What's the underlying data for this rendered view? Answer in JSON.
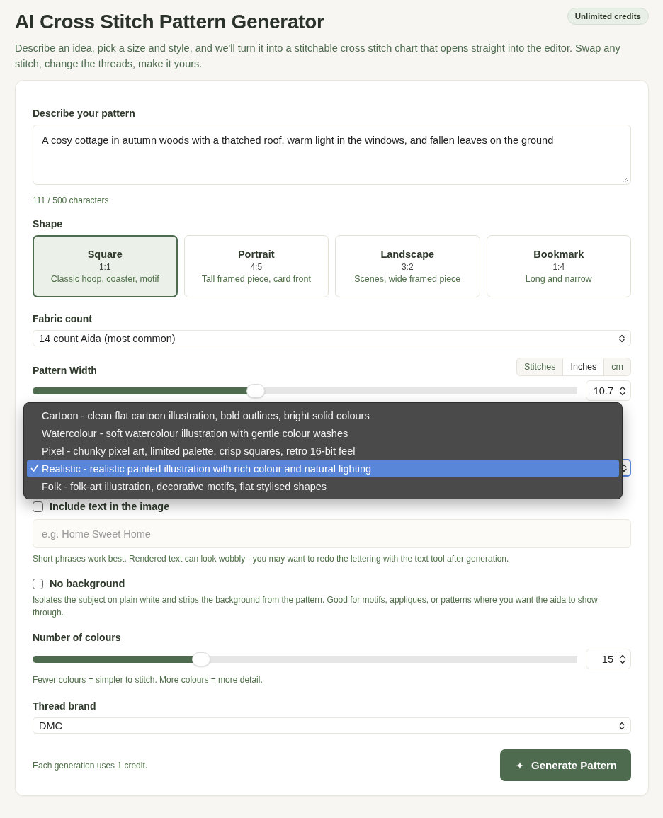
{
  "header": {
    "title": "AI Cross Stitch Pattern Generator",
    "badge": "Unlimited credits",
    "intro": "Describe an idea, pick a size and style, and we'll turn it into a stitchable cross stitch chart that opens straight into the editor. Swap any stitch, change the threads, make it yours."
  },
  "description": {
    "label": "Describe your pattern",
    "value": "A cosy cottage in autumn woods with a thatched roof, warm light in the windows, and fallen leaves on the ground",
    "counter": "111 / 500 characters"
  },
  "shape": {
    "label": "Shape",
    "options": [
      {
        "name": "Square",
        "ratio": "1:1",
        "desc": "Classic hoop, coaster, motif",
        "selected": true
      },
      {
        "name": "Portrait",
        "ratio": "4:5",
        "desc": "Tall framed piece, card front",
        "selected": false
      },
      {
        "name": "Landscape",
        "ratio": "3:2",
        "desc": "Scenes, wide framed piece",
        "selected": false
      },
      {
        "name": "Bookmark",
        "ratio": "1:4",
        "desc": "Long and narrow",
        "selected": false
      }
    ]
  },
  "fabric": {
    "label": "Fabric count",
    "value": "14 count Aida (most common)"
  },
  "width": {
    "label": "Pattern Width",
    "units": [
      {
        "label": "Stitches",
        "selected": false
      },
      {
        "label": "Inches",
        "selected": true
      },
      {
        "label": "cm",
        "selected": false
      }
    ],
    "level": 0.41,
    "value": "10.7"
  },
  "style_menu": {
    "options": [
      {
        "label": "Cartoon - clean flat cartoon illustration, bold outlines, bright solid colours",
        "selected": false
      },
      {
        "label": "Watercolour - soft watercolour illustration with gentle colour washes",
        "selected": false
      },
      {
        "label": "Pixel - chunky pixel art, limited palette, crisp squares, retro 16-bit feel",
        "selected": false
      },
      {
        "label": "Realistic - realistic painted illustration with rich colour and natural lighting",
        "selected": true
      },
      {
        "label": "Folk - folk-art illustration, decorative motifs, flat stylised shapes",
        "selected": false
      }
    ]
  },
  "include_text": {
    "label": "Include text in the image",
    "checked": false,
    "placeholder": "e.g. Home Sweet Home",
    "hint": "Short phrases work best. Rendered text can look wobbly - you may want to redo the lettering with the text tool after generation."
  },
  "no_background": {
    "label": "No background",
    "checked": false,
    "hint": "Isolates the subject on plain white and strips the background from the pattern. Good for motifs, appliques, or patterns where you want the aida to show through."
  },
  "colours": {
    "label": "Number of colours",
    "level": 0.31,
    "value": "15",
    "hint": "Fewer colours = simpler to stitch. More colours = more detail."
  },
  "thread": {
    "label": "Thread brand",
    "value": "DMC"
  },
  "footer": {
    "note": "Each generation uses 1 credit.",
    "button": "Generate Pattern"
  }
}
